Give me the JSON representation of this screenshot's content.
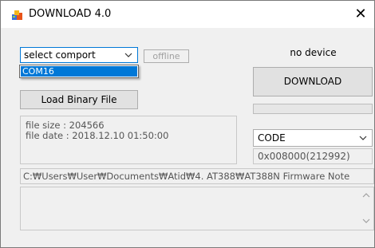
{
  "window": {
    "title": "DOWNLOAD 4.0",
    "close_glyph": "✕"
  },
  "comport": {
    "selected": "select comport",
    "options": [
      "COM16"
    ],
    "highlighted_option": "COM16"
  },
  "connection": {
    "status": "offline"
  },
  "load_button_label": "Load Binary File",
  "device": {
    "status": "no device",
    "download_label": "DOWNLOAD",
    "progress": 0
  },
  "file_info": {
    "size_line": "file size : 204566",
    "date_line": "file date : 2018.12.10 01:50:00"
  },
  "code_region": {
    "selected": "CODE",
    "address": "0x008000(212992)"
  },
  "file_path": "C:₩Users₩User₩Documents₩Atid₩4. AT388₩AT388N Firmware Note",
  "icons": {
    "app": "download-app-icon",
    "close": "close-icon",
    "dropdown": "chevron-down-icon",
    "scroll_up": "scroll-up-arrow-icon",
    "scroll_down": "scroll-down-arrow-icon"
  },
  "colors": {
    "accent": "#0078d7",
    "progress_fill": "#06b025"
  }
}
